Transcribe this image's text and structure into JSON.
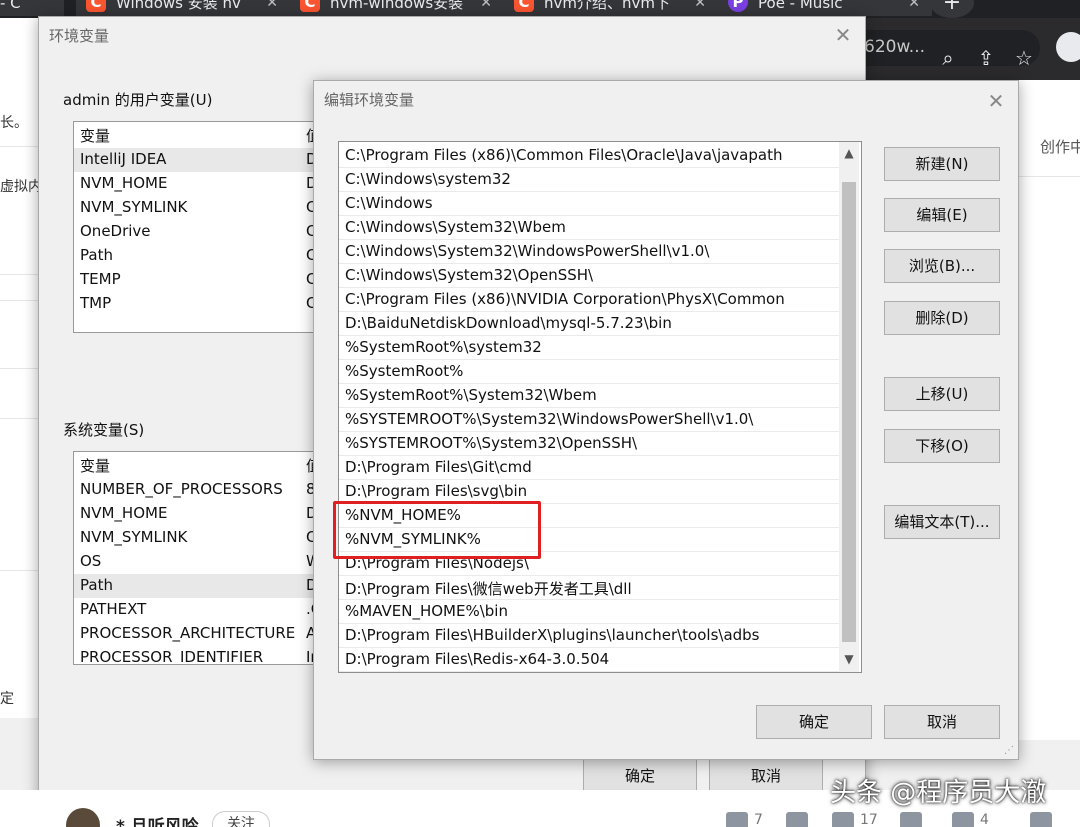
{
  "browser": {
    "tabs": [
      {
        "label": "Windows 安装 nv",
        "favicon": "C"
      },
      {
        "label": "nvm-windows安装",
        "favicon": "C"
      },
      {
        "label": "nvm介绍、nvm下",
        "favicon": "C"
      },
      {
        "label": "Poe - Music",
        "favicon": "P"
      }
    ],
    "first_tab_fragment": "- C",
    "address_fragment": "620w..."
  },
  "page_left": {
    "fragments": [
      "长。",
      "虚拟内",
      "定"
    ]
  },
  "page_right": {
    "text": "创作中"
  },
  "bottom_strip": {
    "author": "* 旦听风吟",
    "follow": "关注",
    "likes": "7",
    "stars": "17",
    "comments": "4"
  },
  "env_dialog": {
    "title": "环境变量",
    "user_section_label": "admin 的用户变量(U)",
    "user_columns": [
      "变量",
      "值"
    ],
    "user_vars": [
      {
        "name": "IntelliJ IDEA",
        "value": "D"
      },
      {
        "name": "NVM_HOME",
        "value": "D"
      },
      {
        "name": "NVM_SYMLINK",
        "value": "C"
      },
      {
        "name": "OneDrive",
        "value": "C"
      },
      {
        "name": "Path",
        "value": "C"
      },
      {
        "name": "TEMP",
        "value": "C"
      },
      {
        "name": "TMP",
        "value": "C"
      }
    ],
    "system_section_label": "系统变量(S)",
    "system_columns": [
      "变量",
      "值"
    ],
    "system_vars": [
      {
        "name": "NUMBER_OF_PROCESSORS",
        "value": "8"
      },
      {
        "name": "NVM_HOME",
        "value": "D"
      },
      {
        "name": "NVM_SYMLINK",
        "value": "C"
      },
      {
        "name": "OS",
        "value": "W"
      },
      {
        "name": "Path",
        "value": "D"
      },
      {
        "name": "PATHEXT",
        "value": ".C"
      },
      {
        "name": "PROCESSOR_ARCHITECTURE",
        "value": "A"
      },
      {
        "name": "PROCESSOR_IDENTIFIER",
        "value": "In"
      }
    ],
    "ok_label": "确定",
    "cancel_label": "取消"
  },
  "edit_dialog": {
    "title": "编辑环境变量",
    "paths": [
      "C:\\Program Files (x86)\\Common Files\\Oracle\\Java\\javapath",
      "C:\\Windows\\system32",
      "C:\\Windows",
      "C:\\Windows\\System32\\Wbem",
      "C:\\Windows\\System32\\WindowsPowerShell\\v1.0\\",
      "C:\\Windows\\System32\\OpenSSH\\",
      "C:\\Program Files (x86)\\NVIDIA Corporation\\PhysX\\Common",
      "D:\\BaiduNetdiskDownload\\mysql-5.7.23\\bin",
      "%SystemRoot%\\system32",
      "%SystemRoot%",
      "%SystemRoot%\\System32\\Wbem",
      "%SYSTEMROOT%\\System32\\WindowsPowerShell\\v1.0\\",
      "%SYSTEMROOT%\\System32\\OpenSSH\\",
      "D:\\Program Files\\Git\\cmd",
      "D:\\Program Files\\svg\\bin",
      "%NVM_HOME%",
      "%NVM_SYMLINK%",
      "D:\\Program Files\\Nodejs\\",
      "D:\\Program Files\\微信web开发者工具\\dll",
      "%MAVEN_HOME%\\bin",
      "D:\\Program Files\\HBuilderX\\plugins\\launcher\\tools\\adbs",
      "D:\\Program Files\\Redis-x64-3.0.504"
    ],
    "buttons": {
      "new": "新建(N)",
      "edit": "编辑(E)",
      "browse": "浏览(B)...",
      "delete": "删除(D)",
      "move_up": "上移(U)",
      "move_down": "下移(O)",
      "edit_text": "编辑文本(T)..."
    },
    "ok_label": "确定",
    "cancel_label": "取消"
  },
  "watermark": "头条 @程序员大澈",
  "colors": {
    "highlight": "#e02020",
    "csdn_favicon": "#fc5531",
    "poe_favicon": "#7b3fe4"
  }
}
